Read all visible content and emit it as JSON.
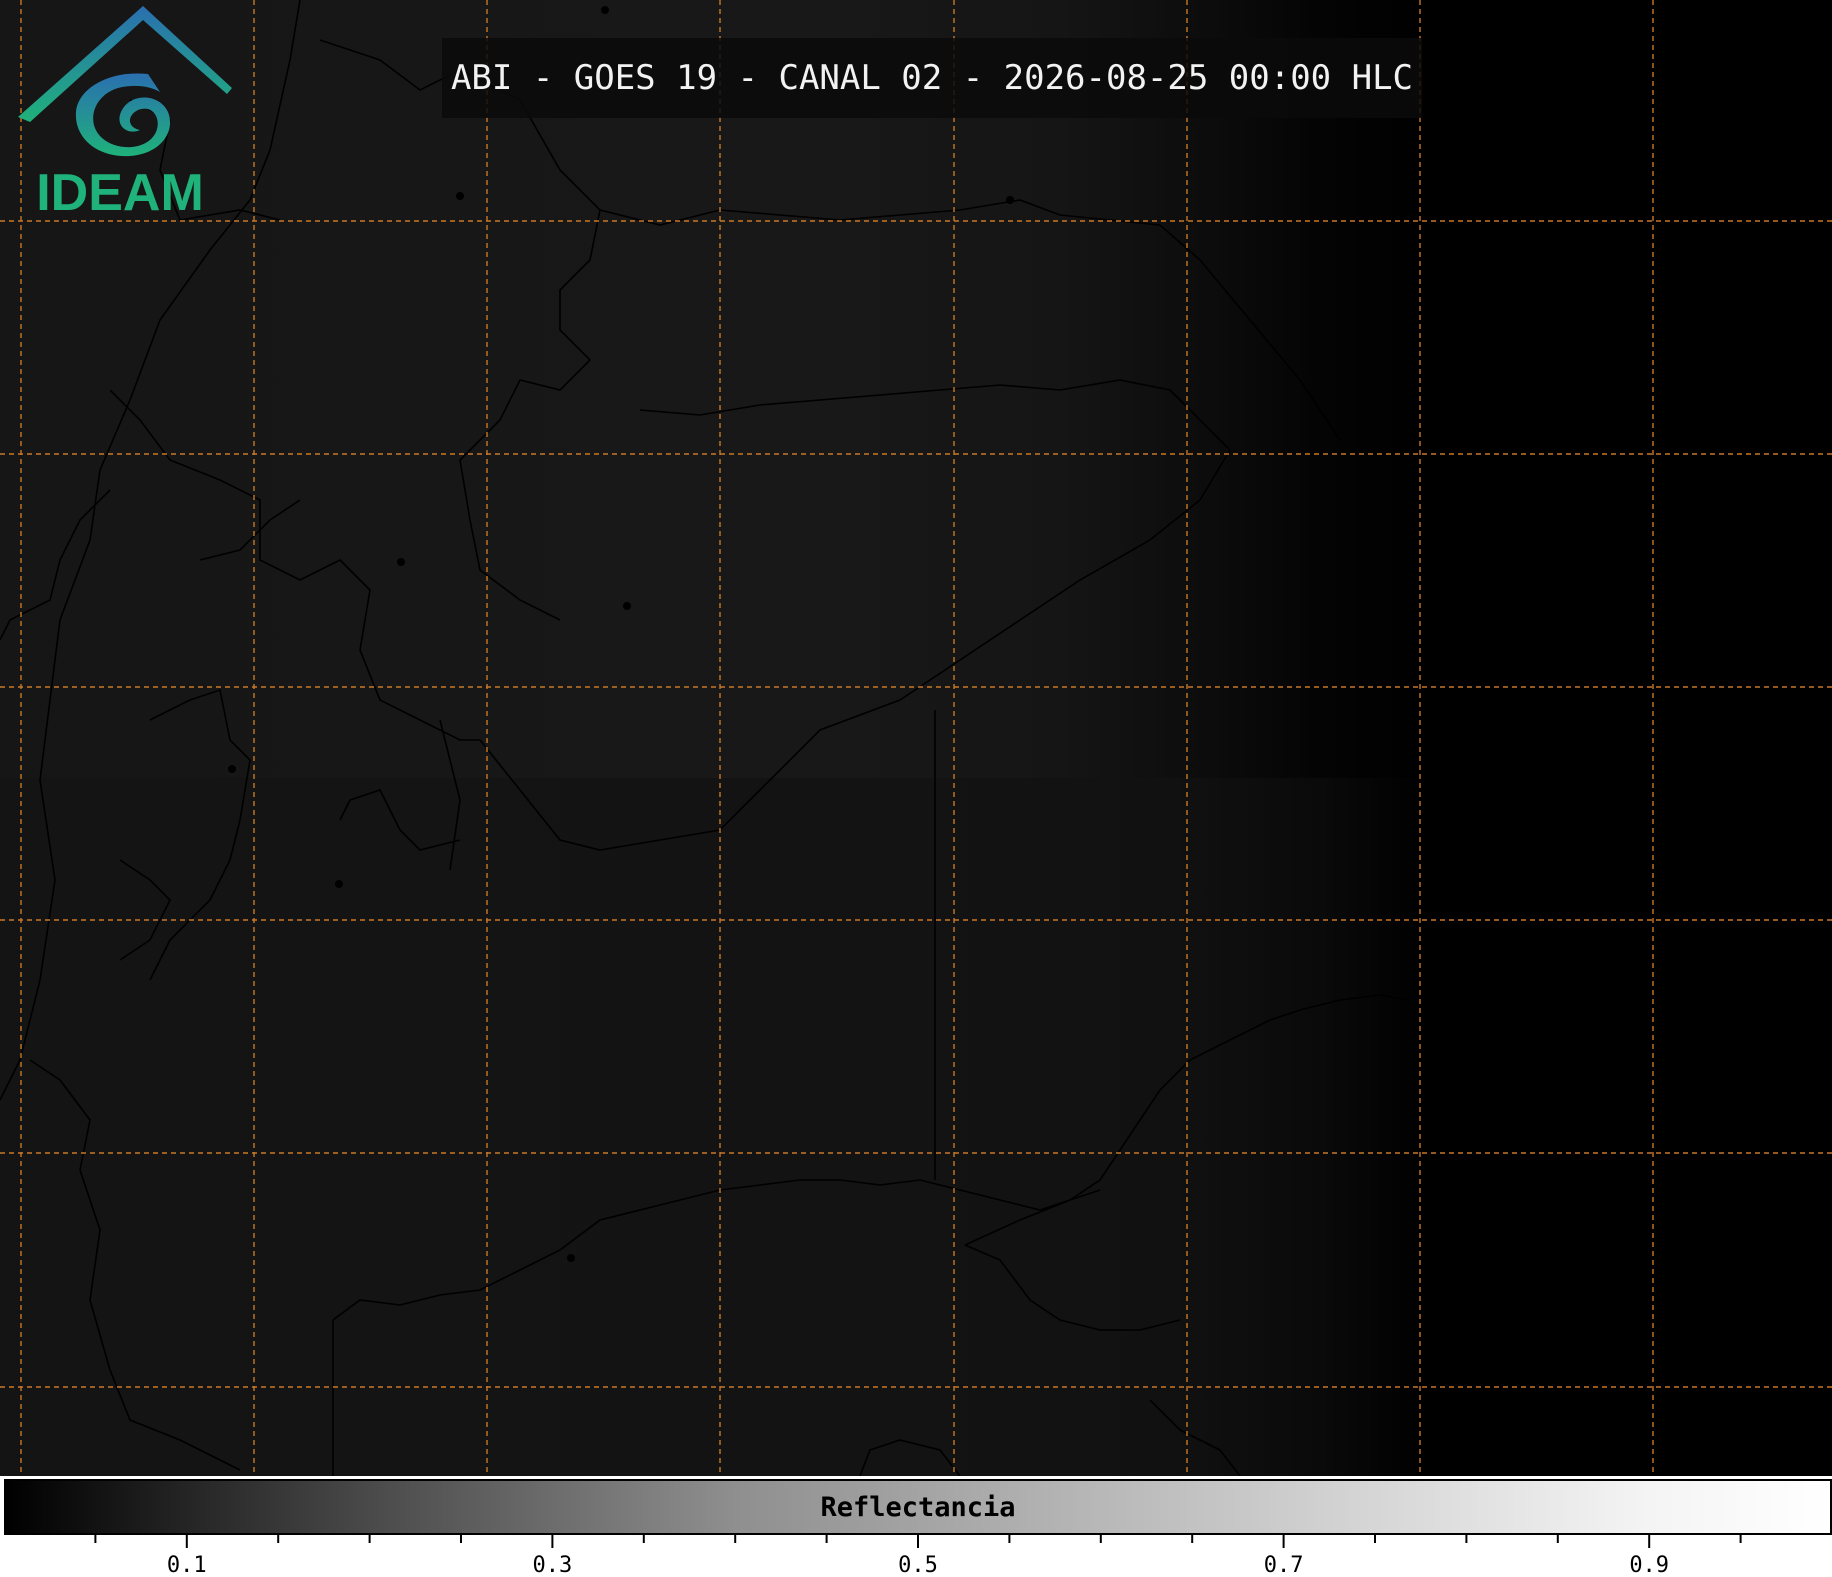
{
  "title": "ABI - GOES 19 - CANAL 02 - 2026-08-25 00:00 HLC",
  "colors": {
    "background": "#161616",
    "grid_line": "#c8782a",
    "border_line": "#000000",
    "logo_blue": "#2a6fb0",
    "logo_green": "#1fb27a"
  },
  "logo": {
    "text": "IDEAM",
    "icon": "ideam-swirl-logo-icon"
  },
  "colorbar": {
    "label": "Reflectancia",
    "range": [
      0,
      1
    ],
    "colormap": "gray",
    "major_ticks": [
      0.1,
      0.3,
      0.5,
      0.7,
      0.9
    ],
    "major_tick_labels": [
      "0.1",
      "0.3",
      "0.5",
      "0.7",
      "0.9"
    ],
    "minor_ticks": [
      0.05,
      0.15,
      0.2,
      0.25,
      0.35,
      0.4,
      0.45,
      0.55,
      0.6,
      0.65,
      0.75,
      0.8,
      0.85,
      0.95
    ]
  },
  "map": {
    "gridlines": "dashed",
    "night_side": "right"
  }
}
